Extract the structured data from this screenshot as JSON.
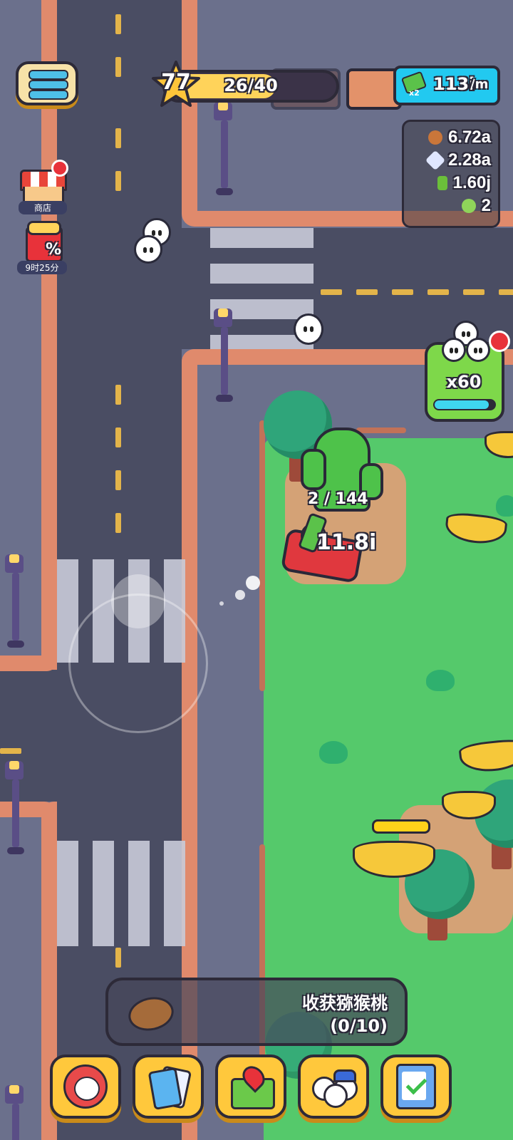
{
  "hud": {
    "level": "77",
    "xp_text": "26/40",
    "xp_progress": 0.65,
    "income_multiplier": "x2",
    "income_value": "113i",
    "income_unit": "/m"
  },
  "resources": [
    {
      "icon": "cookie-icon",
      "value": "6.72a",
      "color": "#c9763a"
    },
    {
      "icon": "crystal-icon",
      "value": "2.28a",
      "color": "#dfe6ff"
    },
    {
      "icon": "cash-icon",
      "value": "1.60j",
      "color": "#6bbf3a"
    },
    {
      "icon": "potion-icon",
      "value": "2",
      "color": "#8fd45a"
    }
  ],
  "side": {
    "shop_label": "商店",
    "gift_timer": "9时25分",
    "gift_badge": "%"
  },
  "crowd_badge": {
    "count": "x60",
    "progress": 0.9
  },
  "player": {
    "carry": "2 / 144",
    "float_value": "11.8i"
  },
  "quest": {
    "title": "收获猕猴桃",
    "progress": "(0/10)"
  },
  "bottom_bar": [
    {
      "name": "hero-button",
      "icon": "hero-icon"
    },
    {
      "name": "cards-button",
      "icon": "cards-icon"
    },
    {
      "name": "map-button",
      "icon": "map-icon"
    },
    {
      "name": "team-button",
      "icon": "team-icon"
    },
    {
      "name": "tasks-button",
      "icon": "checklist-icon"
    }
  ],
  "colors": {
    "road": "#454861",
    "park": "#55c96b",
    "accent": "#ffd35a",
    "income": "#22c9f0"
  }
}
